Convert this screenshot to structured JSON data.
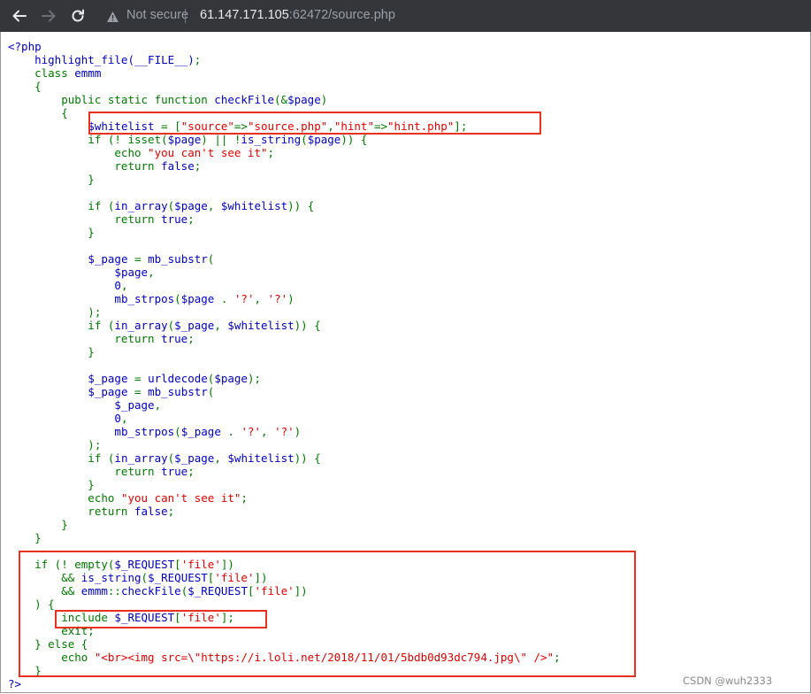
{
  "browser": {
    "back_icon": "arrow-left-icon",
    "forward_icon": "arrow-right-icon",
    "reload_icon": "reload-icon",
    "security_icon": "warning-triangle-icon",
    "security_label": "Not secure",
    "url_host": "61.147.171.105",
    "url_rest": ":62472/source.php"
  },
  "code_lines": [
    [
      [
        "d",
        "<?php"
      ]
    ],
    [
      [
        "d",
        "    highlight_file(__FILE__)"
      ],
      [
        "k",
        ";"
      ]
    ],
    [
      [
        "k",
        "    class "
      ],
      [
        "d",
        "emmm"
      ]
    ],
    [
      [
        "k",
        "    {"
      ]
    ],
    [
      [
        "k",
        "        public static function "
      ],
      [
        "d",
        "checkFile"
      ],
      [
        "k",
        "(&"
      ],
      [
        "d",
        "$page"
      ],
      [
        "k",
        ")"
      ]
    ],
    [
      [
        "k",
        "        {"
      ]
    ],
    [
      [
        "k",
        "            "
      ],
      [
        "d",
        "$whitelist "
      ],
      [
        "k",
        "= ["
      ],
      [
        "s",
        "\"source\""
      ],
      [
        "k",
        "=>"
      ],
      [
        "s",
        "\"source.php\""
      ],
      [
        "k",
        ","
      ],
      [
        "s",
        "\"hint\""
      ],
      [
        "k",
        "=>"
      ],
      [
        "s",
        "\"hint.php\""
      ],
      [
        "k",
        "];"
      ]
    ],
    [
      [
        "k",
        "            if (! isset("
      ],
      [
        "d",
        "$page"
      ],
      [
        "k",
        ") || !"
      ],
      [
        "d",
        "is_string"
      ],
      [
        "k",
        "("
      ],
      [
        "d",
        "$page"
      ],
      [
        "k",
        ")) {"
      ]
    ],
    [
      [
        "k",
        "                echo "
      ],
      [
        "s",
        "\"you can't see it\""
      ],
      [
        "k",
        ";"
      ]
    ],
    [
      [
        "k",
        "                return "
      ],
      [
        "d",
        "false"
      ],
      [
        "k",
        ";"
      ]
    ],
    [
      [
        "k",
        "            }"
      ]
    ],
    [
      [
        "k",
        ""
      ]
    ],
    [
      [
        "k",
        "            if ("
      ],
      [
        "d",
        "in_array"
      ],
      [
        "k",
        "("
      ],
      [
        "d",
        "$page"
      ],
      [
        "k",
        ", "
      ],
      [
        "d",
        "$whitelist"
      ],
      [
        "k",
        ")) {"
      ]
    ],
    [
      [
        "k",
        "                return "
      ],
      [
        "d",
        "true"
      ],
      [
        "k",
        ";"
      ]
    ],
    [
      [
        "k",
        "            }"
      ]
    ],
    [
      [
        "k",
        ""
      ]
    ],
    [
      [
        "k",
        "            "
      ],
      [
        "d",
        "$_page "
      ],
      [
        "k",
        "= "
      ],
      [
        "d",
        "mb_substr"
      ],
      [
        "k",
        "("
      ]
    ],
    [
      [
        "k",
        "                "
      ],
      [
        "d",
        "$page"
      ],
      [
        "k",
        ","
      ]
    ],
    [
      [
        "k",
        "                "
      ],
      [
        "d",
        "0"
      ],
      [
        "k",
        ","
      ]
    ],
    [
      [
        "k",
        "                "
      ],
      [
        "d",
        "mb_strpos"
      ],
      [
        "k",
        "("
      ],
      [
        "d",
        "$page "
      ],
      [
        "k",
        ". "
      ],
      [
        "s",
        "'?'"
      ],
      [
        "k",
        ", "
      ],
      [
        "s",
        "'?'"
      ],
      [
        "k",
        ")"
      ]
    ],
    [
      [
        "k",
        "            );"
      ]
    ],
    [
      [
        "k",
        "            if ("
      ],
      [
        "d",
        "in_array"
      ],
      [
        "k",
        "("
      ],
      [
        "d",
        "$_page"
      ],
      [
        "k",
        ", "
      ],
      [
        "d",
        "$whitelist"
      ],
      [
        "k",
        ")) {"
      ]
    ],
    [
      [
        "k",
        "                return "
      ],
      [
        "d",
        "true"
      ],
      [
        "k",
        ";"
      ]
    ],
    [
      [
        "k",
        "            }"
      ]
    ],
    [
      [
        "k",
        ""
      ]
    ],
    [
      [
        "k",
        "            "
      ],
      [
        "d",
        "$_page "
      ],
      [
        "k",
        "= "
      ],
      [
        "d",
        "urldecode"
      ],
      [
        "k",
        "("
      ],
      [
        "d",
        "$page"
      ],
      [
        "k",
        ");"
      ]
    ],
    [
      [
        "k",
        "            "
      ],
      [
        "d",
        "$_page "
      ],
      [
        "k",
        "= "
      ],
      [
        "d",
        "mb_substr"
      ],
      [
        "k",
        "("
      ]
    ],
    [
      [
        "k",
        "                "
      ],
      [
        "d",
        "$_page"
      ],
      [
        "k",
        ","
      ]
    ],
    [
      [
        "k",
        "                "
      ],
      [
        "d",
        "0"
      ],
      [
        "k",
        ","
      ]
    ],
    [
      [
        "k",
        "                "
      ],
      [
        "d",
        "mb_strpos"
      ],
      [
        "k",
        "("
      ],
      [
        "d",
        "$_page "
      ],
      [
        "k",
        ". "
      ],
      [
        "s",
        "'?'"
      ],
      [
        "k",
        ", "
      ],
      [
        "s",
        "'?'"
      ],
      [
        "k",
        ")"
      ]
    ],
    [
      [
        "k",
        "            );"
      ]
    ],
    [
      [
        "k",
        "            if ("
      ],
      [
        "d",
        "in_array"
      ],
      [
        "k",
        "("
      ],
      [
        "d",
        "$_page"
      ],
      [
        "k",
        ", "
      ],
      [
        "d",
        "$whitelist"
      ],
      [
        "k",
        ")) {"
      ]
    ],
    [
      [
        "k",
        "                return "
      ],
      [
        "d",
        "true"
      ],
      [
        "k",
        ";"
      ]
    ],
    [
      [
        "k",
        "            }"
      ]
    ],
    [
      [
        "k",
        "            echo "
      ],
      [
        "s",
        "\"you can't see it\""
      ],
      [
        "k",
        ";"
      ]
    ],
    [
      [
        "k",
        "            return "
      ],
      [
        "d",
        "false"
      ],
      [
        "k",
        ";"
      ]
    ],
    [
      [
        "k",
        "        }"
      ]
    ],
    [
      [
        "k",
        "    }"
      ]
    ],
    [
      [
        "k",
        ""
      ]
    ],
    [
      [
        "k",
        "    if (! empty("
      ],
      [
        "d",
        "$_REQUEST"
      ],
      [
        "k",
        "["
      ],
      [
        "s",
        "'file'"
      ],
      [
        "k",
        "])"
      ]
    ],
    [
      [
        "k",
        "        && "
      ],
      [
        "d",
        "is_string"
      ],
      [
        "k",
        "("
      ],
      [
        "d",
        "$_REQUEST"
      ],
      [
        "k",
        "["
      ],
      [
        "s",
        "'file'"
      ],
      [
        "k",
        "])"
      ]
    ],
    [
      [
        "k",
        "        && "
      ],
      [
        "d",
        "emmm"
      ],
      [
        "k",
        "::"
      ],
      [
        "d",
        "checkFile"
      ],
      [
        "k",
        "("
      ],
      [
        "d",
        "$_REQUEST"
      ],
      [
        "k",
        "["
      ],
      [
        "s",
        "'file'"
      ],
      [
        "k",
        "])"
      ]
    ],
    [
      [
        "k",
        "    ) {"
      ]
    ],
    [
      [
        "k",
        "        include "
      ],
      [
        "d",
        "$_REQUEST"
      ],
      [
        "k",
        "["
      ],
      [
        "s",
        "'file'"
      ],
      [
        "k",
        "];"
      ]
    ],
    [
      [
        "k",
        "        exit;"
      ]
    ],
    [
      [
        "k",
        "    } else {"
      ]
    ],
    [
      [
        "k",
        "        echo "
      ],
      [
        "s",
        "\"<br><img src=\\\"https://i.loli.net/2018/11/01/5bdb0d93dc794.jpg\\\" />\""
      ],
      [
        "k",
        ";"
      ]
    ],
    [
      [
        "k",
        "    }"
      ]
    ],
    [
      [
        "d",
        "?>"
      ]
    ]
  ],
  "annotations": {
    "color": "#e8311f"
  },
  "watermark": "CSDN @wuh2333"
}
